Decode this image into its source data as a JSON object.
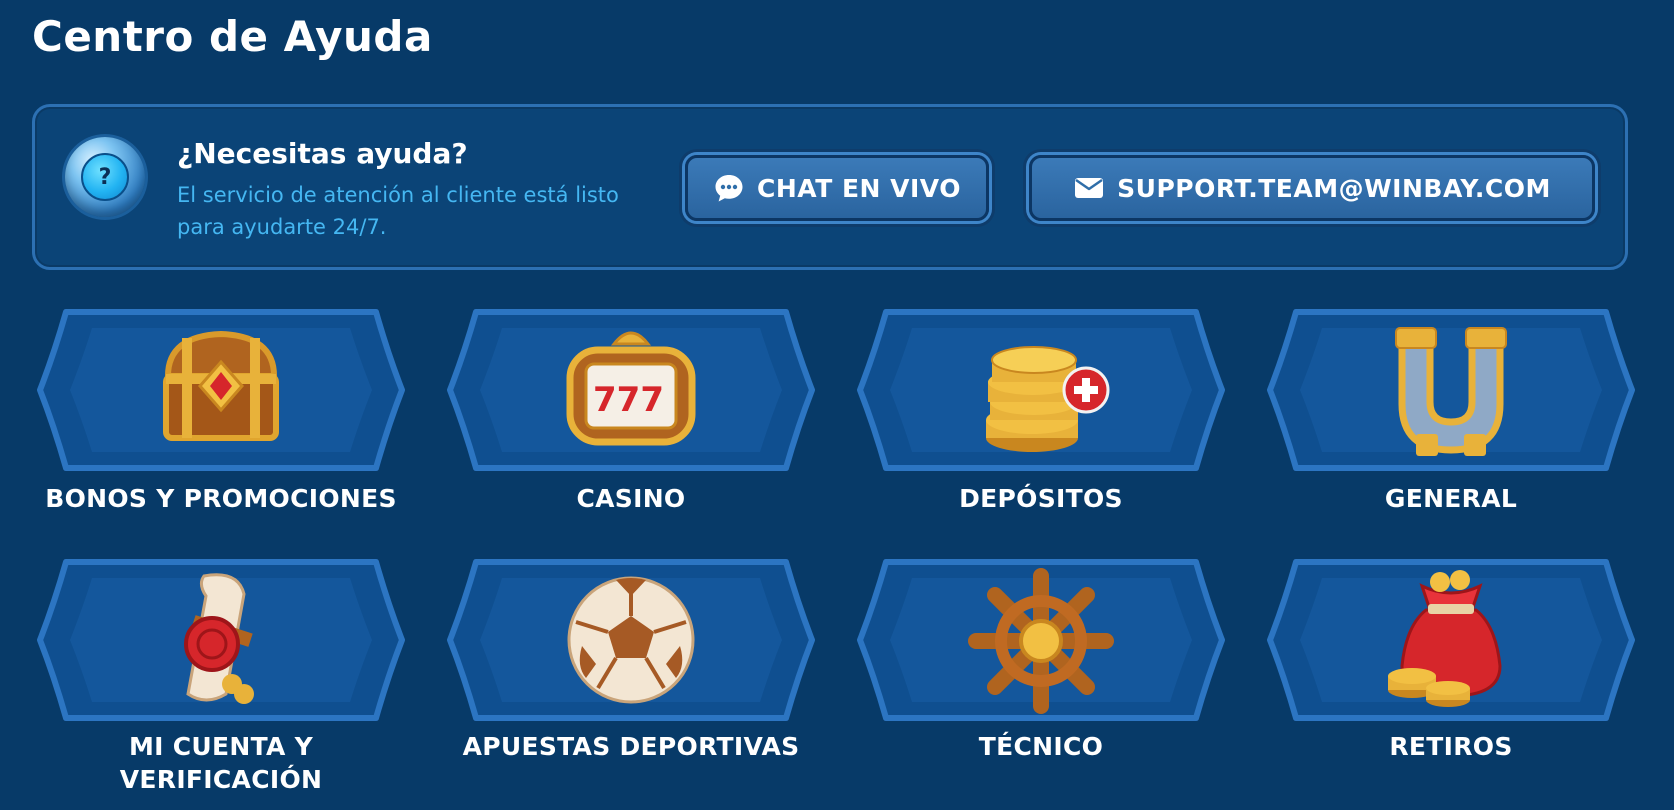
{
  "page": {
    "title": "Centro de Ayuda"
  },
  "help": {
    "title": "¿Necesitas ayuda?",
    "description": "El servicio de atención al cliente está listo para ayudarte 24/7.",
    "question_mark": "?",
    "chat_label": "CHAT EN VIVO",
    "email_label": "SUPPORT.TEAM@WINBAY.COM"
  },
  "categories": [
    {
      "label": "BONOS Y PROMOCIONES",
      "icon": "treasure-chest-icon"
    },
    {
      "label": "CASINO",
      "icon": "slot-machine-icon"
    },
    {
      "label": "DEPÓSITOS",
      "icon": "coin-stack-icon"
    },
    {
      "label": "GENERAL",
      "icon": "horseshoe-icon"
    },
    {
      "label": "MI CUENTA Y VERIFICACIÓN",
      "icon": "scroll-seal-icon"
    },
    {
      "label": "APUESTAS DEPORTIVAS",
      "icon": "soccer-ball-icon"
    },
    {
      "label": "TÉCNICO",
      "icon": "ship-wheel-icon"
    },
    {
      "label": "RETIROS",
      "icon": "money-bag-icon"
    }
  ],
  "colors": {
    "background": "#073a68",
    "panel": "#0b4477",
    "panel_border": "#2c70b3",
    "accent_text": "#45b7f2",
    "button": "#2f6ea9",
    "card": "#0f4f90",
    "card_border": "#2c75c2"
  }
}
